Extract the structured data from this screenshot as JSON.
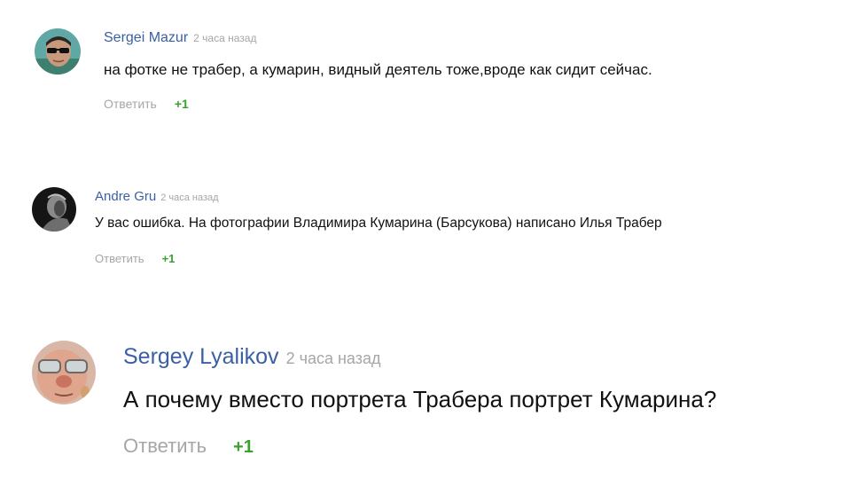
{
  "comments": [
    {
      "author": "Sergei Mazur",
      "time": "2 часа назад",
      "text": "на фотке не трабер, а кумарин, видный деятель тоже,вроде как сидит сейчас.",
      "reply_label": "Ответить",
      "votes": "+1"
    },
    {
      "author": "Andre Gru",
      "time": "2 часа назад",
      "text": "У вас ошибка. На фотографии Владимира Кумарина (Барсукова) написано Илья Трабер",
      "reply_label": "Ответить",
      "votes": "+1"
    },
    {
      "author": "Sergey Lyalikov",
      "time": "2 часа назад",
      "text": "А почему вместо портрета Трабера портрет Кумарина?",
      "reply_label": "Ответить",
      "votes": "+1"
    }
  ],
  "colors": {
    "author": "#3b5fa4",
    "muted": "#a6a6a6",
    "text": "#111111",
    "vote_positive": "#3aa130"
  }
}
